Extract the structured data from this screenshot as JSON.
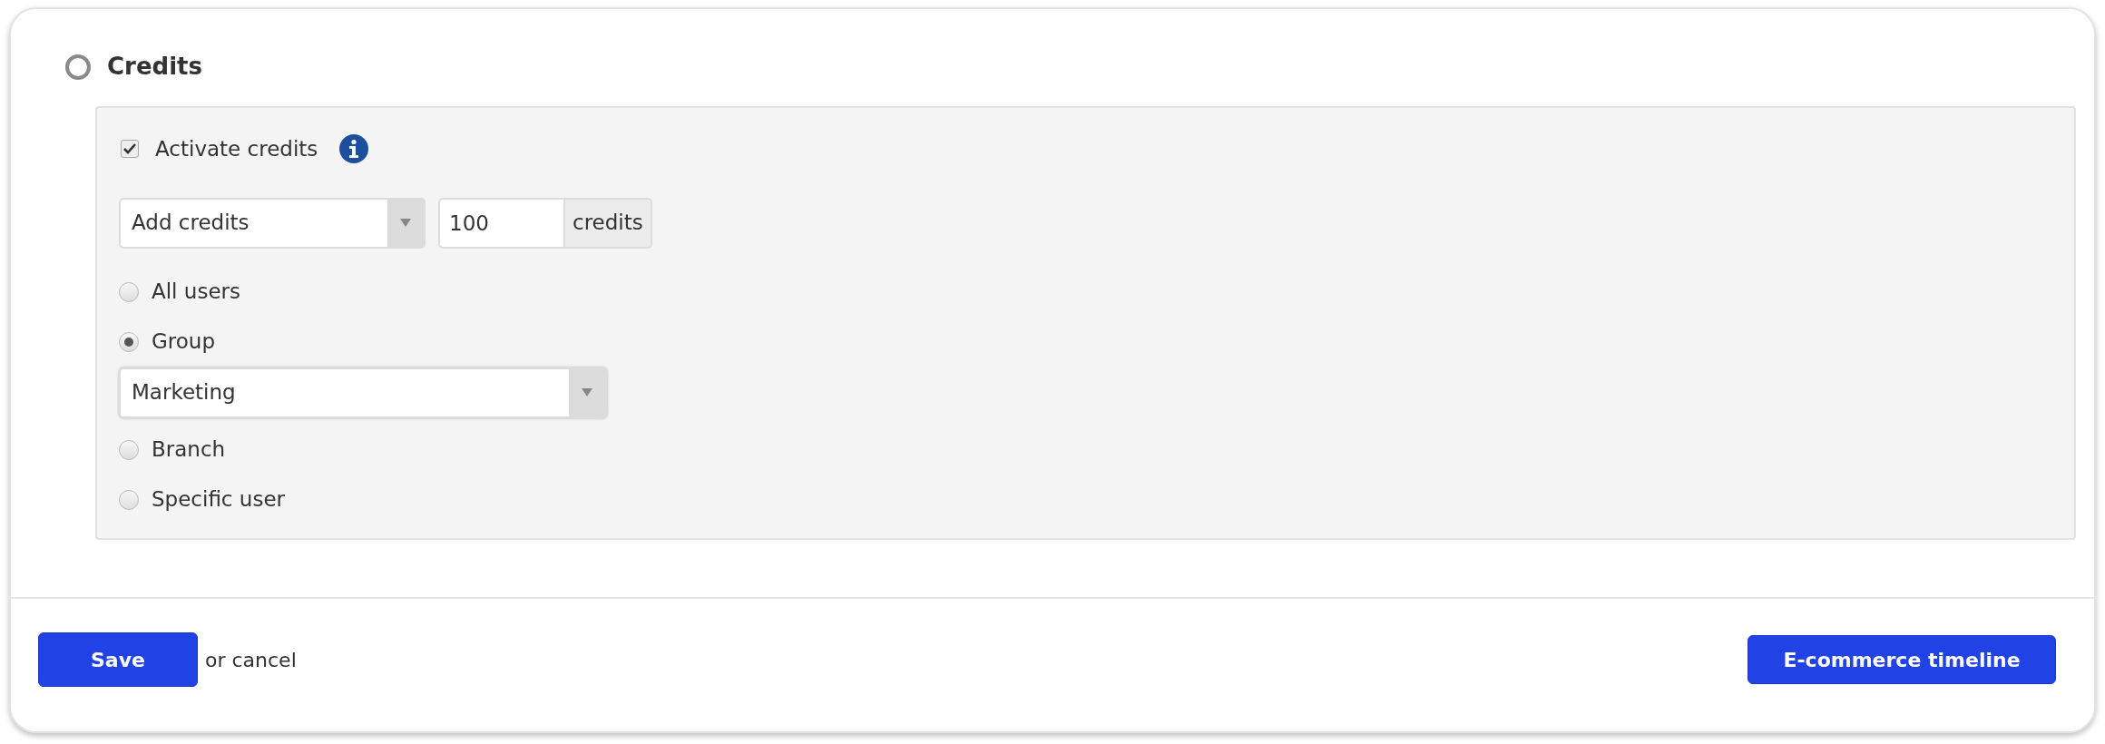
{
  "section": {
    "title": "Credits",
    "checked": false
  },
  "activate": {
    "label": "Activate credits",
    "checked": true
  },
  "action_select": {
    "value": "Add credits"
  },
  "amount": {
    "value": "100",
    "unit": "credits"
  },
  "targets": [
    {
      "label": "All users",
      "selected": false
    },
    {
      "label": "Group",
      "selected": true
    },
    {
      "label": "Branch",
      "selected": false
    },
    {
      "label": "Specific user",
      "selected": false
    }
  ],
  "group_select": {
    "value": "Marketing"
  },
  "footer": {
    "save": "Save",
    "cancel": "or cancel",
    "timeline": "E-commerce timeline"
  }
}
